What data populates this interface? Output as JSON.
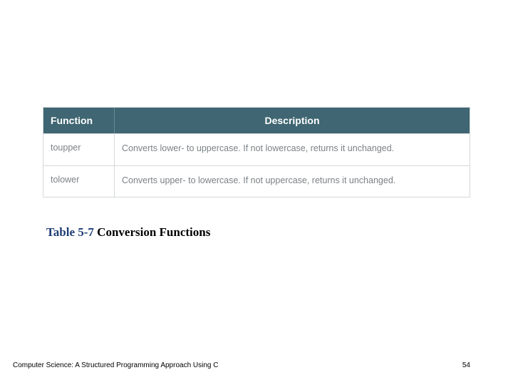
{
  "table": {
    "header": {
      "function": "Function",
      "description": "Description"
    },
    "rows": [
      {
        "function": "toupper",
        "description": "Converts lower- to uppercase. If not lowercase, returns it unchanged."
      },
      {
        "function": "tolower",
        "description": "Converts upper- to lowercase. If not uppercase, returns it unchanged."
      }
    ]
  },
  "caption": {
    "lead": "Table  5-7",
    "rest": "  Conversion Functions"
  },
  "footer": {
    "book": "Computer Science: A Structured Programming Approach Using C",
    "page": "54"
  }
}
